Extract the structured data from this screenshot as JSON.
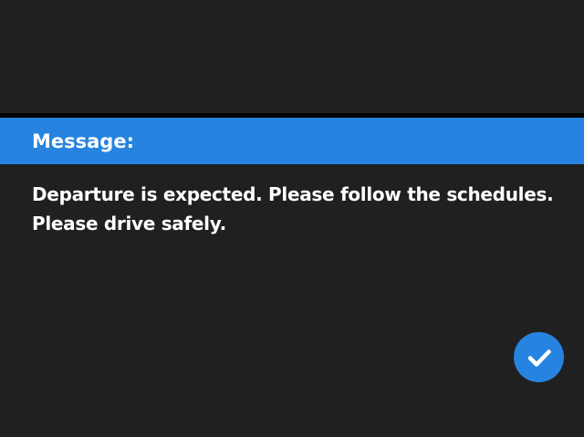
{
  "dialog": {
    "title": "Message:",
    "lines": [
      "Departure is expected. Please follow the schedules.",
      "Please drive safely."
    ],
    "confirm_icon": "checkmark-icon"
  },
  "colors": {
    "background": "#202020",
    "accent": "#2683e0",
    "text": "#ffffff"
  }
}
